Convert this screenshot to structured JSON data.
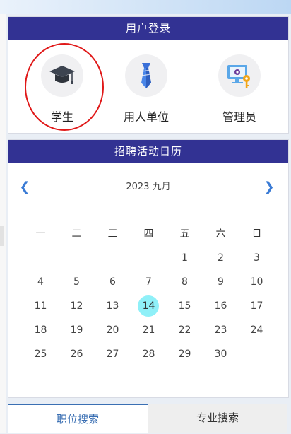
{
  "login": {
    "title": "用户登录",
    "roles": [
      {
        "label": "学生",
        "icon": "graduation-cap-icon"
      },
      {
        "label": "用人单位",
        "icon": "necktie-icon"
      },
      {
        "label": "管理员",
        "icon": "monitor-key-icon"
      }
    ],
    "highlight_color": "#e01818"
  },
  "calendar": {
    "title": "招聘活动日历",
    "month_label": "2023 九月",
    "weekdays": [
      "一",
      "二",
      "三",
      "四",
      "五",
      "六",
      "日"
    ],
    "weeks": [
      [
        "",
        "",
        "",
        "",
        "1",
        "2",
        "3"
      ],
      [
        "4",
        "5",
        "6",
        "7",
        "8",
        "9",
        "10"
      ],
      [
        "11",
        "12",
        "13",
        "14",
        "15",
        "16",
        "17"
      ],
      [
        "18",
        "19",
        "20",
        "21",
        "22",
        "23",
        "24"
      ],
      [
        "25",
        "26",
        "27",
        "28",
        "29",
        "30",
        ""
      ]
    ],
    "today": "14",
    "today_color": "#8ff0f8"
  },
  "tabs": [
    {
      "label": "职位搜索",
      "active": true
    },
    {
      "label": "专业搜索",
      "active": false
    }
  ],
  "colors": {
    "header": "#323293",
    "accent": "#3a6fb3"
  }
}
